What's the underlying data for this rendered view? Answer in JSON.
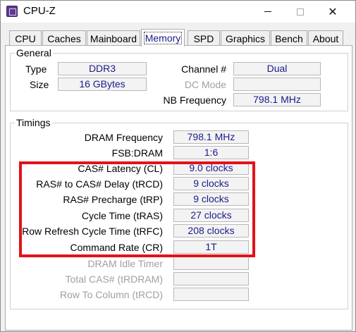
{
  "window": {
    "title": "CPU-Z"
  },
  "tabs": [
    {
      "label": "CPU"
    },
    {
      "label": "Caches"
    },
    {
      "label": "Mainboard"
    },
    {
      "label": "Memory"
    },
    {
      "label": "SPD"
    },
    {
      "label": "Graphics"
    },
    {
      "label": "Bench"
    },
    {
      "label": "About"
    }
  ],
  "general": {
    "title": "General",
    "type_label": "Type",
    "type_value": "DDR3",
    "size_label": "Size",
    "size_value": "16 GBytes",
    "channel_label": "Channel #",
    "channel_value": "Dual",
    "dcmode_label": "DC Mode",
    "dcmode_value": "",
    "nbfreq_label": "NB Frequency",
    "nbfreq_value": "798.1 MHz"
  },
  "timings": {
    "title": "Timings",
    "rows": [
      {
        "label": "DRAM Frequency",
        "value": "798.1 MHz"
      },
      {
        "label": "FSB:DRAM",
        "value": "1:6"
      },
      {
        "label": "CAS# Latency (CL)",
        "value": "9.0 clocks"
      },
      {
        "label": "RAS# to CAS# Delay (tRCD)",
        "value": "9 clocks"
      },
      {
        "label": "RAS# Precharge (tRP)",
        "value": "9 clocks"
      },
      {
        "label": "Cycle Time (tRAS)",
        "value": "27 clocks"
      },
      {
        "label": "Row Refresh Cycle Time (tRFC)",
        "value": "208 clocks"
      },
      {
        "label": "Command Rate (CR)",
        "value": "1T"
      },
      {
        "label": "DRAM Idle Timer",
        "value": ""
      },
      {
        "label": "Total CAS# (tRDRAM)",
        "value": ""
      },
      {
        "label": "Row To Column (tRCD)",
        "value": ""
      }
    ]
  },
  "highlight_color": "#e2121b",
  "value_color": "#1a1a8c"
}
